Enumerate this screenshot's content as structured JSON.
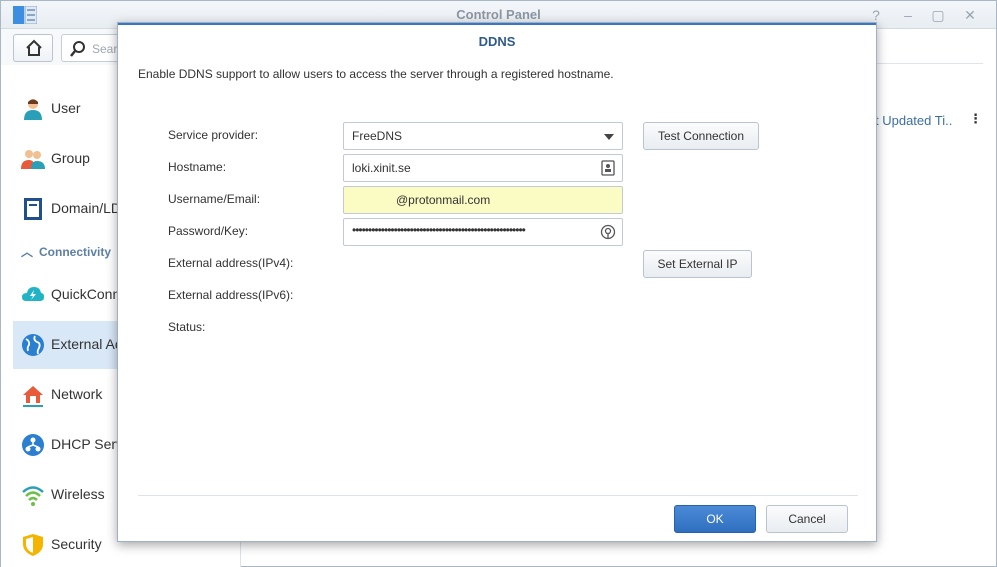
{
  "window": {
    "title": "Control Panel"
  },
  "search": {
    "placeholder": "Sear"
  },
  "sidebar": {
    "top_partial_label": "",
    "items": [
      {
        "label": "User",
        "icon": "user-icon"
      },
      {
        "label": "Group",
        "icon": "group-icon"
      },
      {
        "label": "Domain/LD",
        "icon": "domain-icon"
      },
      {
        "label": "QuickConn",
        "icon": "quickconnect-icon"
      },
      {
        "label": "External Ac",
        "icon": "globe-icon",
        "active": true
      },
      {
        "label": "Network",
        "icon": "network-icon"
      },
      {
        "label": "DHCP Serv",
        "icon": "dhcp-icon"
      },
      {
        "label": "Wireless",
        "icon": "wireless-icon"
      },
      {
        "label": "Security",
        "icon": "shield-icon"
      }
    ],
    "section_connectivity": "Connectivity"
  },
  "list": {
    "column_last_updated": "t Updated Ti..."
  },
  "dialog": {
    "title": "DDNS",
    "description": "Enable DDNS support to allow users to access the server through a registered hostname.",
    "labels": {
      "service_provider": "Service provider:",
      "hostname": "Hostname:",
      "username": "Username/Email:",
      "password": "Password/Key:",
      "ipv4": "External address(IPv4):",
      "ipv6": "External address(IPv6):",
      "status": "Status:"
    },
    "values": {
      "service_provider": "FreeDNS",
      "hostname": "loki.xinit.se",
      "username": "@protonmail.com",
      "password": "••••••••••••••••••••••••••••••••••••••••••••••••••••••"
    },
    "buttons": {
      "test_connection": "Test Connection",
      "set_external_ip": "Set External IP",
      "ok": "OK",
      "cancel": "Cancel"
    }
  },
  "colors": {
    "accent": "#2f6fc0",
    "highlight_field": "#fbfbc4",
    "active_sidebar": "#d9e8f7"
  }
}
